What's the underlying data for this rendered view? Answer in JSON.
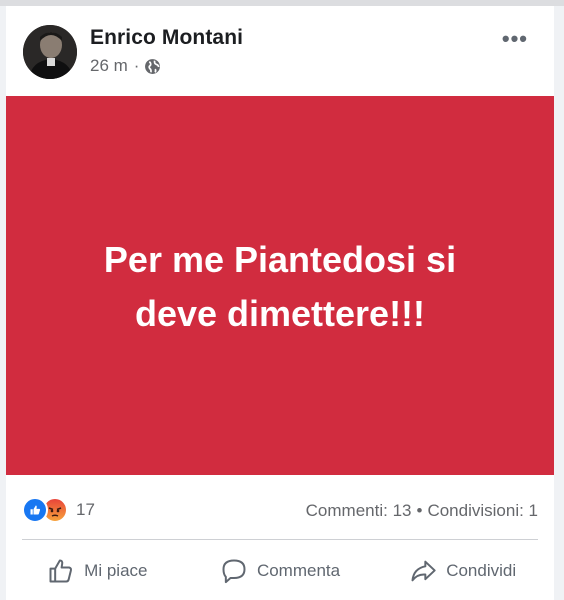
{
  "post": {
    "author": "Enrico Montani",
    "time": "26 m",
    "separator": "·",
    "privacy_icon": "globe-icon",
    "menu_icon": "more-options-icon",
    "menu_glyph": "•••",
    "banner_text": "Per me Piantedosi si deve dimettere!!!",
    "banner_color": "#d12c3f"
  },
  "stats": {
    "reaction_icons": [
      "like-icon",
      "angry-icon"
    ],
    "reactions_count": "17",
    "comments": "Commenti: 13",
    "shares": "Condivisioni: 1",
    "bullet": "•"
  },
  "actions": {
    "like": "Mi piace",
    "comment": "Commenta",
    "share": "Condividi"
  }
}
